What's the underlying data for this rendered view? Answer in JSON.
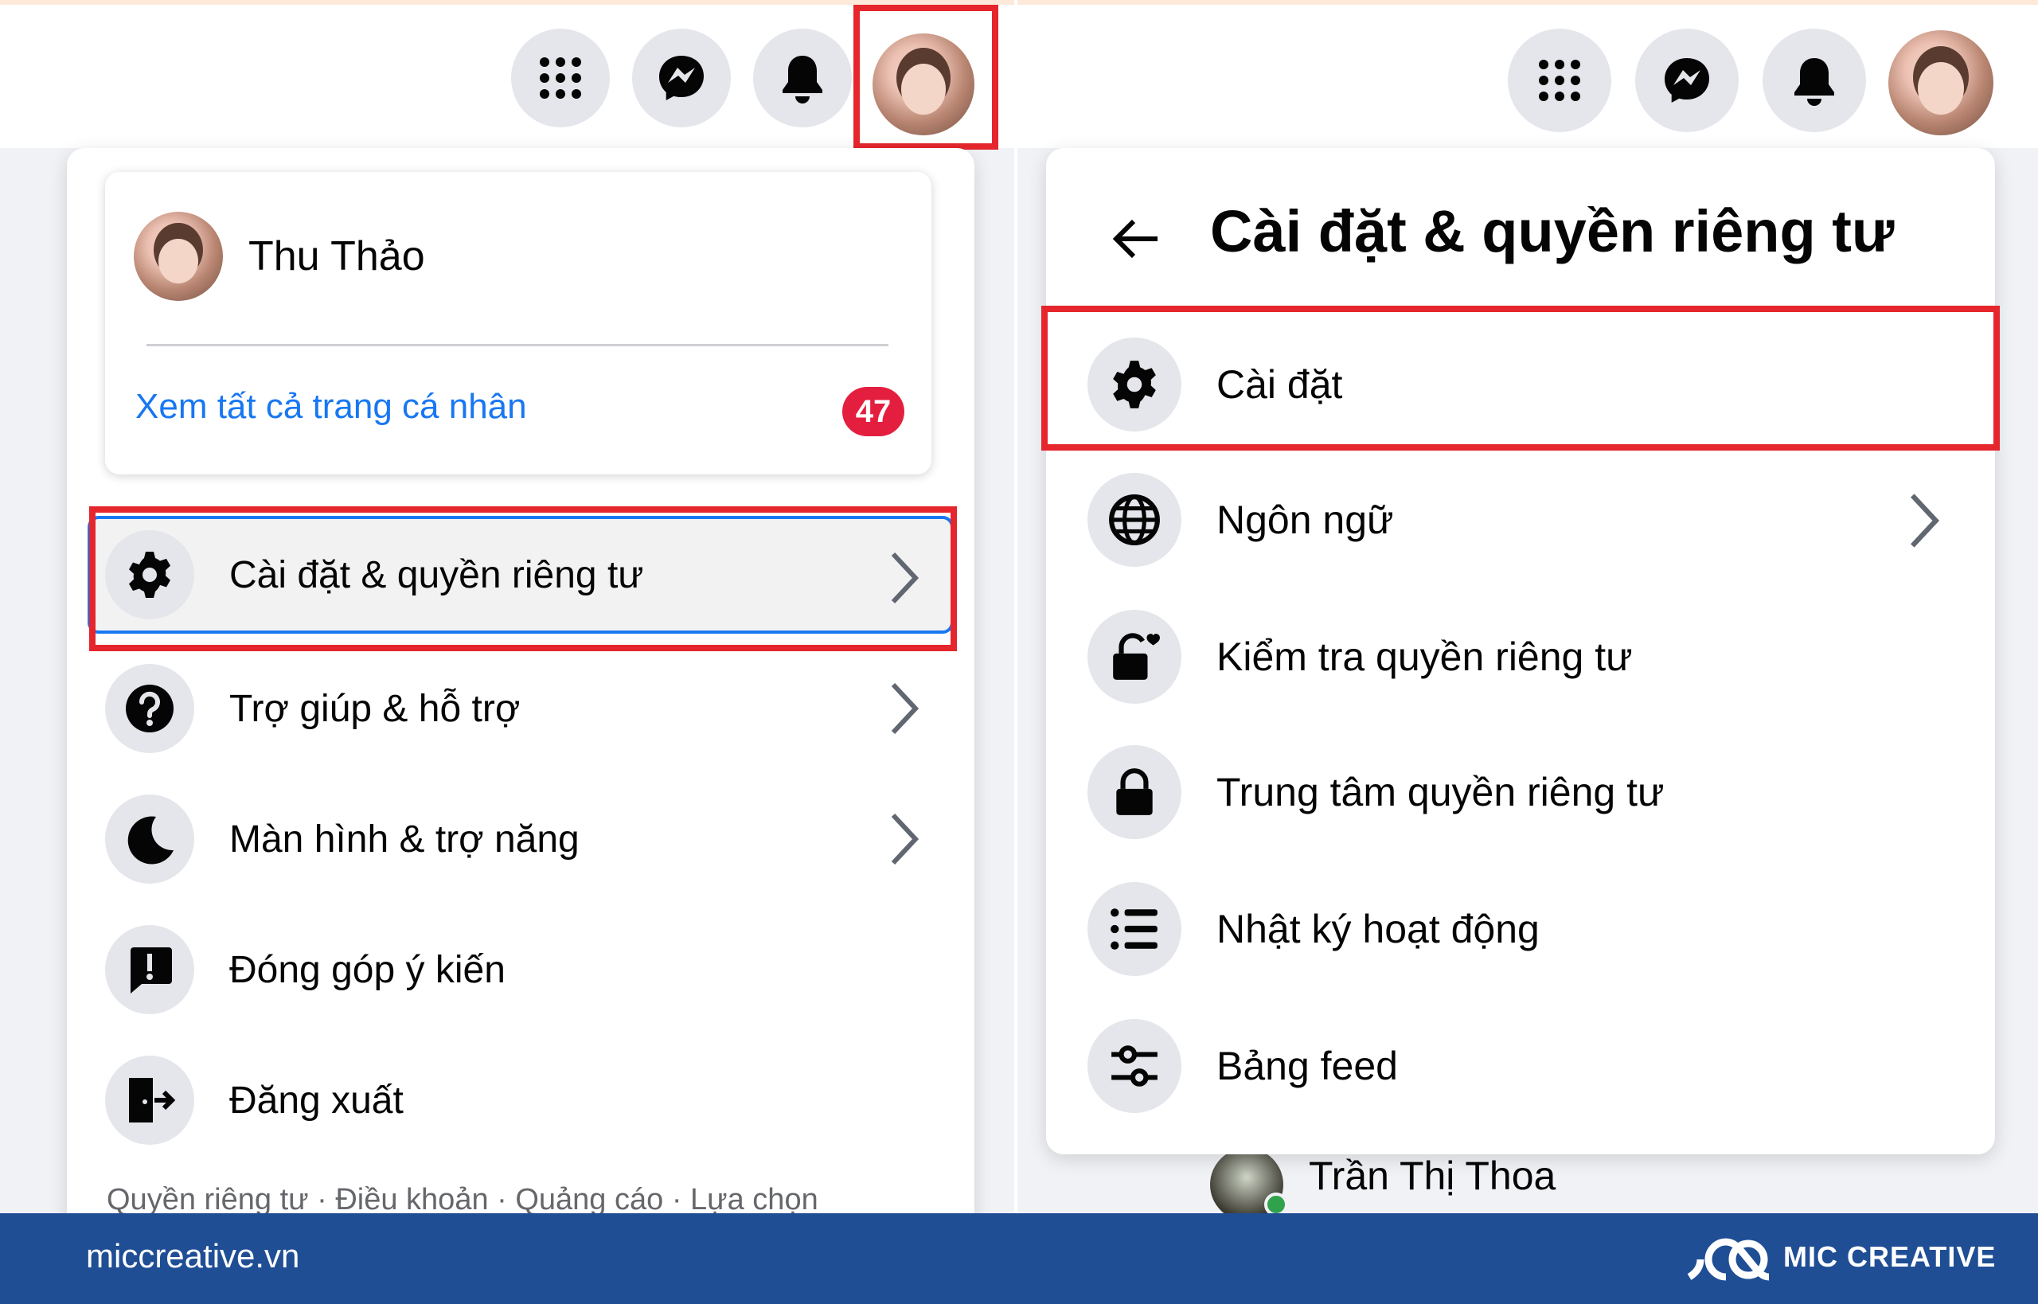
{
  "left_panel": {
    "profile": {
      "name": "Thu Thảo",
      "see_all_profiles": "Xem tất cả trang cá nhân",
      "badge_count": "47"
    },
    "menu_items": [
      {
        "label": "Cài đặt & quyền riêng tư",
        "icon": "gear-icon",
        "has_chevron": true,
        "highlighted": true
      },
      {
        "label": "Trợ giúp & hỗ trợ",
        "icon": "question-icon",
        "has_chevron": true
      },
      {
        "label": "Màn hình & trợ năng",
        "icon": "moon-icon",
        "has_chevron": true
      },
      {
        "label": "Đóng góp ý kiến",
        "icon": "feedback-icon",
        "has_chevron": false
      },
      {
        "label": "Đăng xuất",
        "icon": "logout-icon",
        "has_chevron": false
      }
    ],
    "footer_links": "Quyền riêng tư · Điều khoản · Quảng cáo · Lựa chọn"
  },
  "right_panel": {
    "title": "Cài đặt & quyền riêng tư",
    "menu_items": [
      {
        "label": "Cài đặt",
        "icon": "gear-icon",
        "has_chevron": false,
        "highlighted": true
      },
      {
        "label": "Ngôn ngữ",
        "icon": "globe-icon",
        "has_chevron": true
      },
      {
        "label": "Kiểm tra quyền riêng tư",
        "icon": "lock-heart-icon",
        "has_chevron": false
      },
      {
        "label": "Trung tâm quyền riêng tư",
        "icon": "lock-icon",
        "has_chevron": false
      },
      {
        "label": "Nhật ký hoạt động",
        "icon": "list-icon",
        "has_chevron": false
      },
      {
        "label": "Bảng feed",
        "icon": "sliders-icon",
        "has_chevron": false
      }
    ],
    "contact_below": "Trần Thị Thoa"
  },
  "topbar_icons": [
    "menu-grid-icon",
    "messenger-icon",
    "bell-icon",
    "avatar"
  ],
  "footer": {
    "site": "miccreative.vn",
    "brand": "MIC CREATIVE"
  },
  "colors": {
    "link_blue": "#1877f2",
    "badge_red": "#e41e3f",
    "highlight_red": "#e5262d",
    "footer_blue": "#1f4e95",
    "icon_bg": "#e4e6eb"
  }
}
